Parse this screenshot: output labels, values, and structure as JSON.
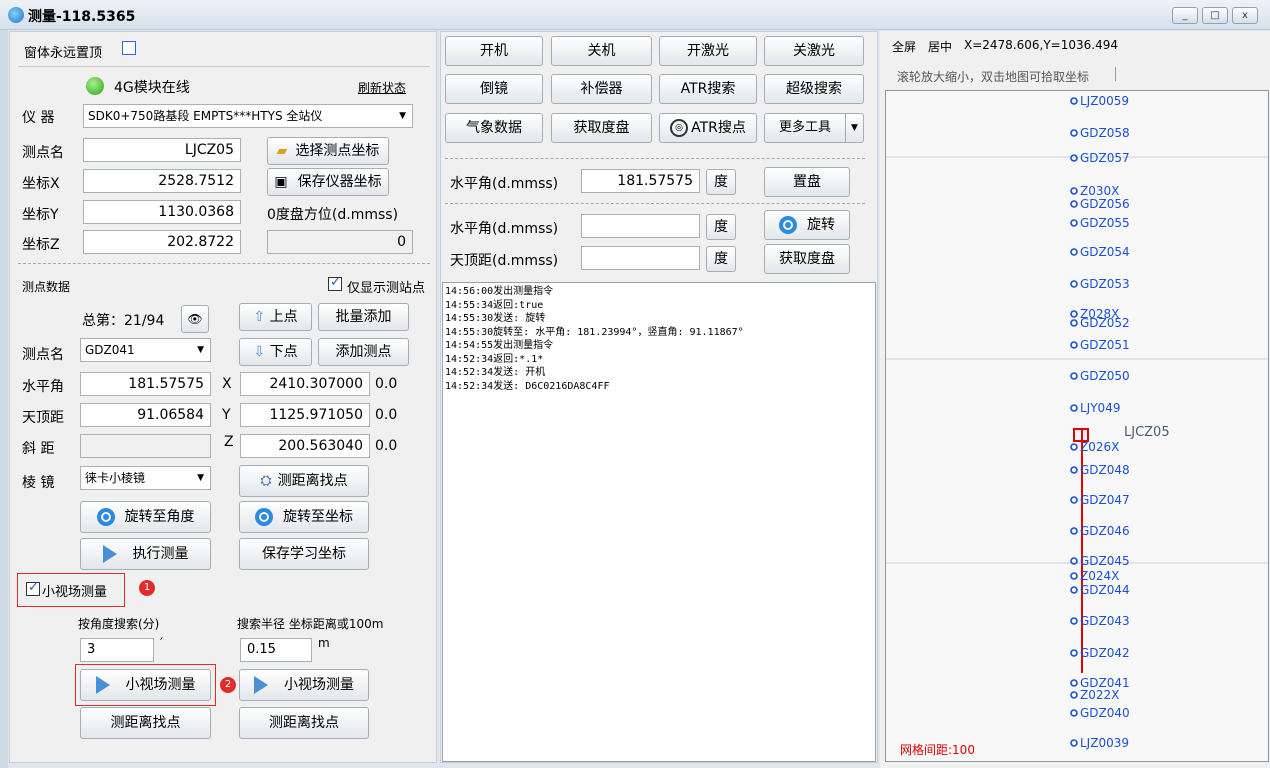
{
  "window": {
    "title": "测量-118.5365",
    "controls": [
      "_",
      "□",
      "x"
    ]
  },
  "top": {
    "always_on_top": "窗体永远置顶",
    "module_status": "4G模块在线",
    "refresh": "刷新状态"
  },
  "instrument": {
    "label": "仪  器",
    "value": "SDK0+750路基段 EMPTS***HTYS 全站仪"
  },
  "station": {
    "name_label": "测点名",
    "name_value": "LJCZ05",
    "x_label": "坐标X",
    "x_value": "2528.7512",
    "y_label": "坐标Y",
    "y_value": "1130.0368",
    "z_label": "坐标Z",
    "z_value": "202.8722",
    "select_btn": "选择测点坐标",
    "save_btn": "保存仪器坐标",
    "zero_label": "0度盘方位(d.mmss)",
    "zero_value": "0"
  },
  "measure": {
    "section": "测点数据",
    "show_only": "仅显示测站点",
    "total": "总第：21/94",
    "up": "上点",
    "batch_add": "批量添加",
    "point_label": "测点名",
    "point_value": "GDZ041",
    "down": "下点",
    "add_point": "添加测点",
    "hz_label": "水平角",
    "hz_value": "181.57575",
    "x_label": "X",
    "x_value": "2410.307000",
    "x_diff": "0.0",
    "zen_label": "天顶距",
    "zen_value": "91.06584",
    "y_label": "Y",
    "y_value": "1125.971050",
    "y_diff": "0.0",
    "slope_label": "斜  距",
    "slope_value": "",
    "z_label": "Z",
    "z_value": "200.563040",
    "z_diff": "0.0",
    "prism_label": "棱  镜",
    "prism_value": "徕卡小棱镜",
    "dist_find": "测距离找点",
    "rot_angle": "旋转至角度",
    "rot_coord": "旋转至坐标",
    "exec": "执行测量",
    "save_learn": "保存学习坐标"
  },
  "small_field": {
    "checkbox": "小视场测量",
    "badge1": "1",
    "angle_label": "按角度搜索(分)",
    "angle_value": "3",
    "angle_unit": "′",
    "radius_label": "搜索半径 坐标距离或100m",
    "radius_value": "0.15",
    "radius_unit": "m",
    "btn1": "小视场测量",
    "badge2": "2",
    "btn2": "小视场测量",
    "find1": "测距离找点",
    "find2": "测距离找点"
  },
  "controls": {
    "row1": [
      "开机",
      "关机",
      "开激光",
      "关激光"
    ],
    "row2": [
      "倒镜",
      "补偿器",
      "ATR搜索",
      "超级搜索"
    ],
    "row3": [
      "气象数据",
      "获取度盘",
      "ATR搜点",
      "更多工具"
    ],
    "hz_label": "水平角(d.mmss)",
    "hz_value": "181.57575",
    "deg": "度",
    "set_disk": "置盘",
    "hz2_label": "水平角(d.mmss)",
    "rotate": "旋转",
    "zen_label": "天顶距(d.mmss)",
    "get_disk": "获取度盘"
  },
  "log": [
    "14:56:00发出测量指令",
    "14:55:34返回:true",
    "14:55:30发送: 旋转",
    "14:55:30旋转至: 水平角: 181.23994°，竖直角: 91.11867°",
    "14:54:55发出测量指令",
    "14:52:34返回:*.1*",
    "14:52:34发送: 开机",
    "14:52:34发送: D6C0216DA8C4FF"
  ],
  "map": {
    "fullscreen": "全屏",
    "center": "居中",
    "coords": "X=2478.606,Y=1036.494",
    "hint": "滚轮放大缩小，双击地图可拾取坐标",
    "grid": "网格间距:100",
    "labels": [
      "LJZ0059",
      "GDZ058",
      "GDZ057",
      "Z030X",
      "GDZ056",
      "GDZ055",
      "GDZ054",
      "GDZ053",
      "Z028X",
      "GDZ052",
      "GDZ051",
      "GDZ050",
      "LJY049",
      "LJCZ05",
      "Z026X",
      "GDZ048",
      "GDZ047",
      "GDZ046",
      "GDZ045",
      "Z024X",
      "GDZ044",
      "GDZ043",
      "GDZ042",
      "GDZ041",
      "Z022X",
      "GDZ040",
      "LJZ0039"
    ],
    "accent": "#e00000",
    "point_color": "#1a4fd6"
  }
}
